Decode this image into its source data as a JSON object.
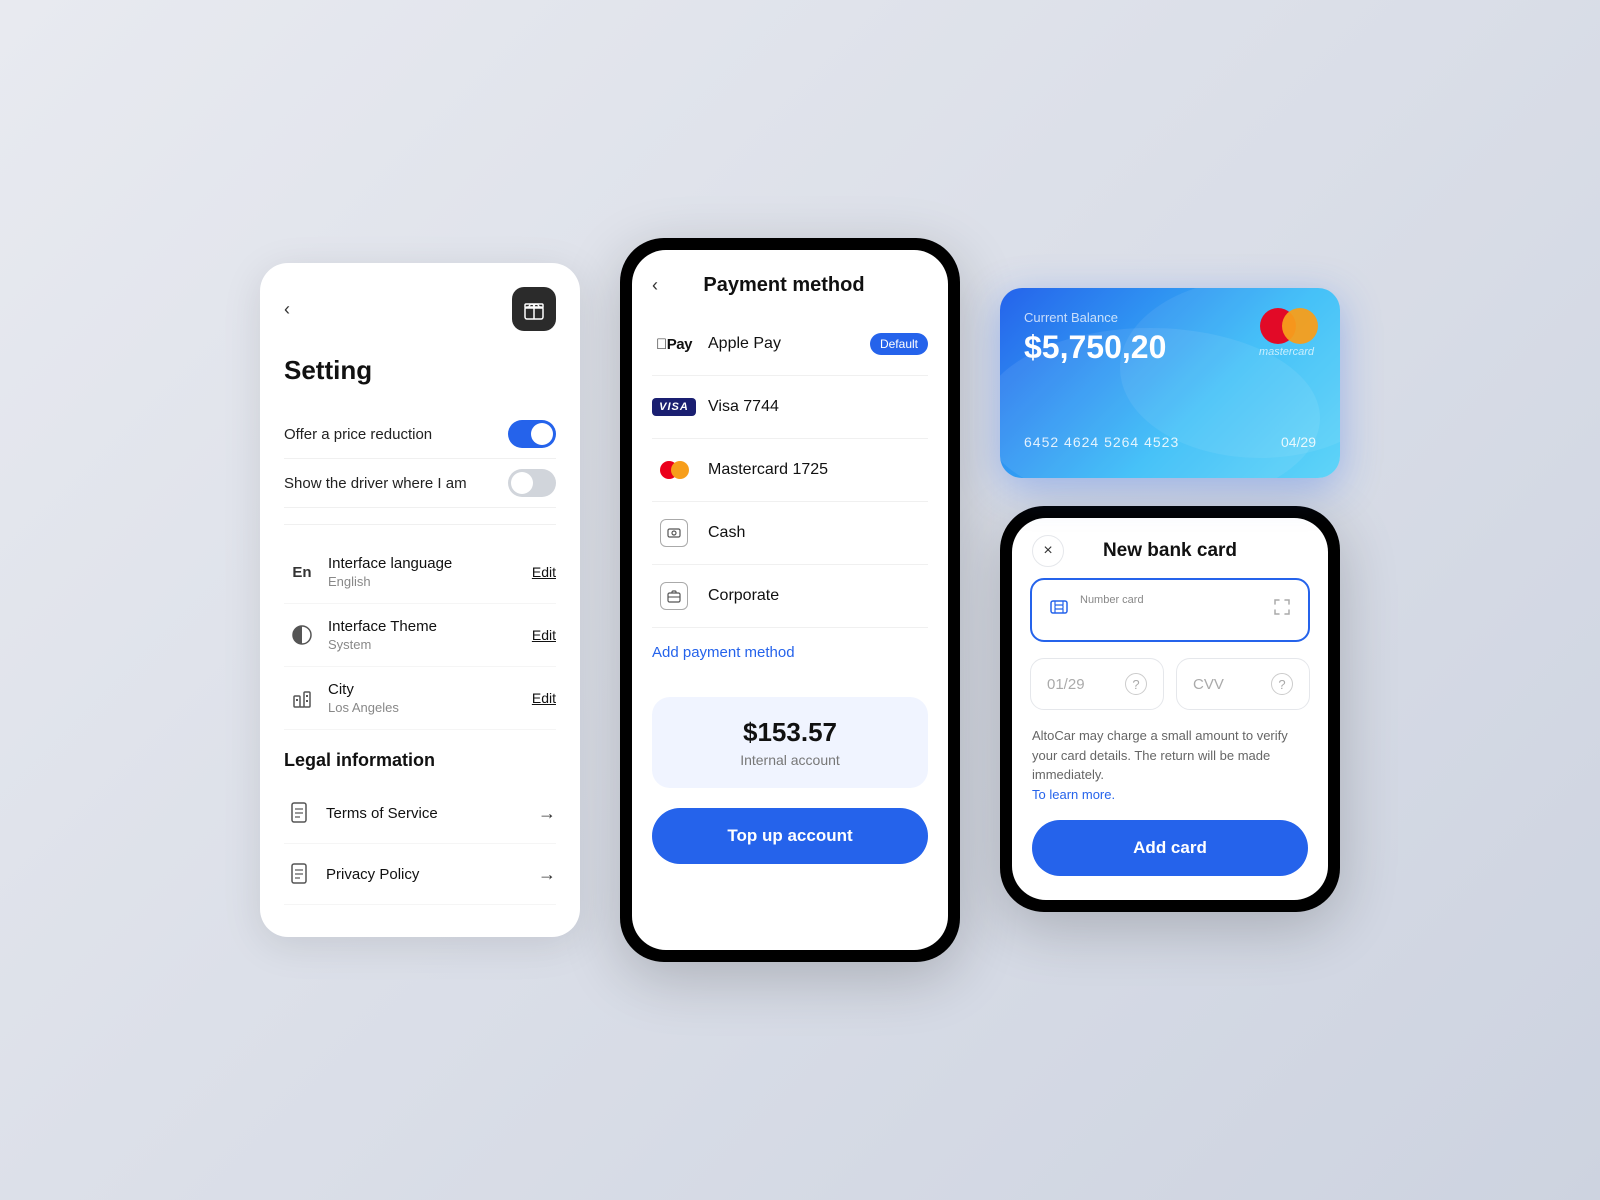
{
  "settings": {
    "title": "Setting",
    "back_label": "‹",
    "toggles": [
      {
        "label": "Offer a price reduction",
        "state": "on"
      },
      {
        "label": "Show the driver where I am",
        "state": "off"
      }
    ],
    "items": [
      {
        "icon": "En",
        "main": "Interface language",
        "sub": "English",
        "edit": "Edit"
      },
      {
        "icon": "☀",
        "main": "Interface Theme",
        "sub": "System",
        "edit": "Edit"
      },
      {
        "icon": "🏢",
        "main": "City",
        "sub": "Los Angeles",
        "edit": "Edit"
      }
    ],
    "legal_title": "Legal information",
    "legal_items": [
      {
        "label": "Terms of Service"
      },
      {
        "label": "Privacy Policy"
      }
    ]
  },
  "payment": {
    "title": "Payment method",
    "back_label": "‹",
    "methods": [
      {
        "type": "applepay",
        "label": "Apple Pay",
        "badge": "Default"
      },
      {
        "type": "visa",
        "label": "Visa  7744",
        "badge": ""
      },
      {
        "type": "mastercard",
        "label": "Mastercard  1725",
        "badge": ""
      },
      {
        "type": "cash",
        "label": "Cash",
        "badge": ""
      },
      {
        "type": "corporate",
        "label": "Corporate",
        "badge": ""
      }
    ],
    "add_label": "Add payment method",
    "internal_amount": "$153.57",
    "internal_label": "Internal account",
    "top_up_label": "Top up account"
  },
  "bank_card": {
    "balance_label": "Current Balance",
    "amount": "$5,750,20",
    "card_number": "6452 4624 5264 4523",
    "expiry": "04/29",
    "brand": "mastercard"
  },
  "new_card": {
    "title": "New bank card",
    "number_label": "Number card",
    "number_placeholder": "",
    "expiry_placeholder": "01/29",
    "cvv_placeholder": "CVV",
    "notice": "AltoCar may charge a small amount to verify your card details. The return will be made immediately.",
    "notice_link": "To learn more.",
    "add_label": "Add card",
    "close_label": "×"
  }
}
